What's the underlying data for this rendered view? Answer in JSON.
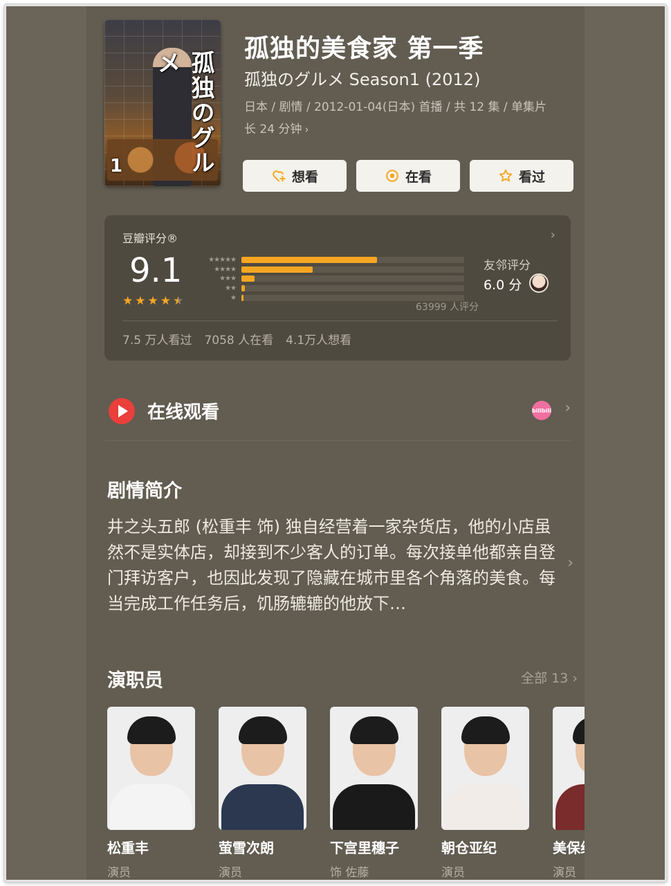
{
  "poster": {
    "title_vertical": "孤独のグルメ",
    "volume": "1"
  },
  "header": {
    "title_zh": "孤独的美食家 第一季",
    "title_original": "孤独のグルメ Season1 (2012)",
    "meta_line1": "日本 / 剧情 / 2012-01-04(日本) 首播 / 共 12 集 / 单集片",
    "meta_line2": "长 24 分钟",
    "meta_chevron": "›"
  },
  "actions": {
    "want": "想看",
    "watching": "在看",
    "watched": "看过"
  },
  "rating": {
    "label": "豆瓣评分®",
    "more": "›",
    "score": "9.1",
    "stars": [
      "★",
      "★",
      "★",
      "★",
      "★"
    ],
    "star_value": 4.5,
    "distribution": [
      {
        "stars": "★★★★★",
        "fraction": 0.61
      },
      {
        "stars": "★★★★",
        "fraction": 0.32
      },
      {
        "stars": "★★★",
        "fraction": 0.06
      },
      {
        "stars": "★★",
        "fraction": 0.015
      },
      {
        "stars": "★",
        "fraction": 0.01
      }
    ],
    "count": "63999 人评分",
    "friends_label": "友邻评分",
    "friends_score": "6.0 分",
    "stats": {
      "watched": "7.5 万人看过",
      "watching": "7058 人在看",
      "want": "4.1万人想看"
    }
  },
  "online": {
    "label": "在线观看",
    "platform_badge": "bilibili",
    "chevron": "›"
  },
  "synopsis": {
    "title": "剧情简介",
    "text": "井之头五郎 (松重丰 饰) 独自经营着一家杂货店，他的小店虽然不是实体店，却接到不少客人的订单。每次接单他都亲自登门拜访客户，也因此发现了隐藏在城市里各个角落的美食。每当完成工作任务后，饥肠辘辘的他放下…",
    "chevron": "›"
  },
  "cast": {
    "title": "演职员",
    "all": "全部 13 ›",
    "people": [
      {
        "name": "松重丰",
        "role": "演员",
        "shirt": "#f4f4f4"
      },
      {
        "name": "萤雪次朗",
        "role": "演员",
        "shirt": "#2b3850"
      },
      {
        "name": "下宫里穗子",
        "role": "饰 佐藤",
        "shirt": "#1a1a1a"
      },
      {
        "name": "朝仓亚纪",
        "role": "演员",
        "shirt": "#f1ece8"
      },
      {
        "name": "美保纯",
        "role": "演员",
        "shirt": "#7a2b2b"
      }
    ]
  }
}
